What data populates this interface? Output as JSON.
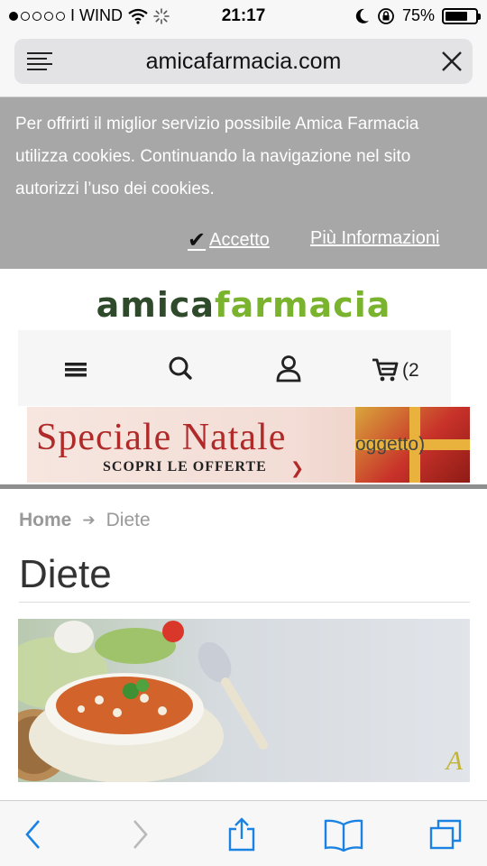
{
  "status_bar": {
    "carrier": "I WIND",
    "time": "21:17",
    "battery_percent": "75%",
    "battery_level": 0.75
  },
  "browser": {
    "url": "amicafarmacia.com"
  },
  "cookie_banner": {
    "message": "Per offrirti il miglior servizio possibile Amica Farmacia utilizza cookies. Continuando la navigazione nel sito autorizzi l’uso dei cookies.",
    "accept_label": "Accetto",
    "more_info_label": "Più Informazioni"
  },
  "site": {
    "logo_part1": "amica",
    "logo_part2": "farmacia",
    "cart_count": "(2"
  },
  "promo": {
    "title": "Speciale Natale",
    "subtitle": "SCOPRI LE OFFERTE",
    "overlay_text": "oggetto)"
  },
  "breadcrumb": {
    "home": "Home",
    "current": "Diete"
  },
  "page": {
    "title": "Diete"
  },
  "colors": {
    "logo_dark": "#2e4a2a",
    "logo_green": "#7ab32e",
    "cookie_bg": "#a7a7a7",
    "ios_blue": "#1a82e2"
  }
}
